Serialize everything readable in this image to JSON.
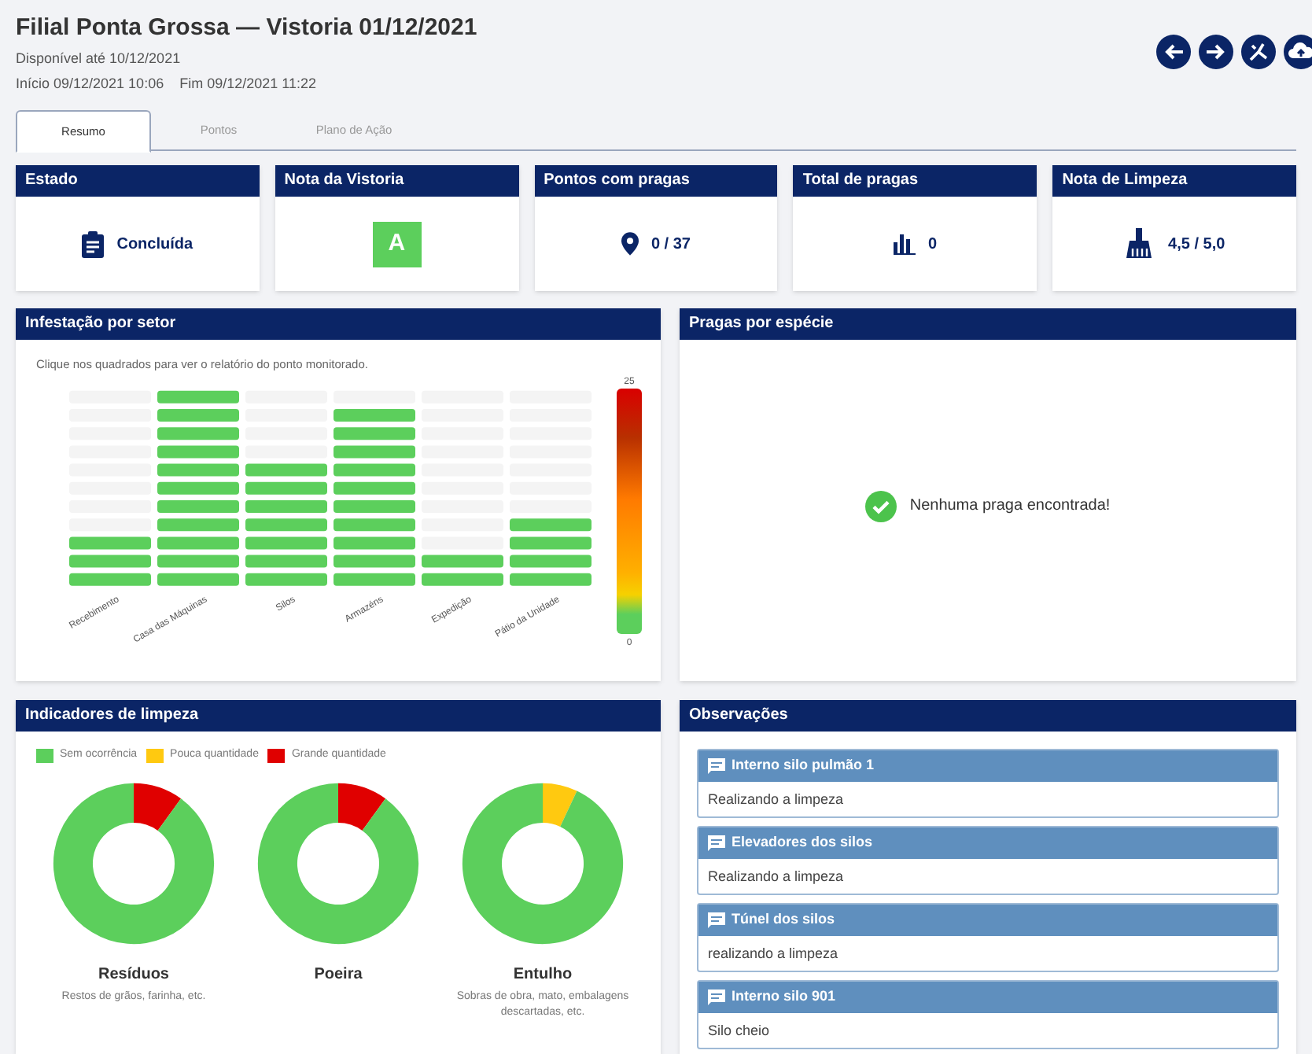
{
  "header": {
    "title": "Filial Ponta Grossa — Vistoria 01/12/2021",
    "available": "Disponível até 10/12/2021",
    "start": "Início 09/12/2021 10:06",
    "end": "Fim 09/12/2021 11:22"
  },
  "toolbar": [
    {
      "kind": "back"
    },
    {
      "kind": "forward"
    },
    {
      "kind": "route"
    },
    {
      "kind": "upload"
    }
  ],
  "tabs": [
    {
      "label": "Resumo",
      "selected": true
    },
    {
      "label": "Pontos",
      "selected": false
    },
    {
      "label": "Plano de Ação",
      "selected": false
    }
  ],
  "summary_cards": [
    {
      "title": "Estado",
      "kind": "status",
      "value": "Concluída"
    },
    {
      "title": "Nota da Vistoria",
      "kind": "grade",
      "value": "A"
    },
    {
      "title": "Pontos com pragas",
      "kind": "points",
      "value": "0 / 37"
    },
    {
      "title": "Total de pragas",
      "kind": "count",
      "value": "0"
    },
    {
      "title": "Nota de Limpeza",
      "kind": "cleaning",
      "value": "4,5 / 5,0"
    }
  ],
  "infestation": {
    "title": "Infestação por setor",
    "hint": "Clique nos quadrados para ver o relatório do ponto monitorado.",
    "scale_max": "25",
    "scale_min": "0",
    "sectors": [
      "Recebimento",
      "Casa das Máquinas",
      "Silos",
      "Armazéns",
      "Expedição",
      "Pátio da Unidade"
    ]
  },
  "pests": {
    "title": "Pragas por espécie",
    "message": "Nenhuma praga encontrada!"
  },
  "cleaning": {
    "title": "Indicadores de limpeza",
    "legend": [
      {
        "label": "Sem ocorrência",
        "color": "#5ccf5c"
      },
      {
        "label": "Pouca quantidade",
        "color": "#ffc910"
      },
      {
        "label": "Grande quantidade",
        "color": "#e00000"
      }
    ],
    "indicators": [
      {
        "name": "Resíduos",
        "description": "Restos de grãos, farinha, etc."
      },
      {
        "name": "Poeira"
      },
      {
        "name": "Entulho",
        "description": "Sobras de obra, mato, embalagens descartadas, etc."
      }
    ]
  },
  "observations": {
    "title": "Observações",
    "items": [
      {
        "title": "Interno silo pulmão 1",
        "text": "Realizando a limpeza"
      },
      {
        "title": "Elevadores dos silos",
        "text": "Realizando a limpeza"
      },
      {
        "title": "Túnel dos silos",
        "text": "realizando a limpeza"
      },
      {
        "title": "Interno silo 901",
        "text": "Silo cheio"
      }
    ]
  }
}
